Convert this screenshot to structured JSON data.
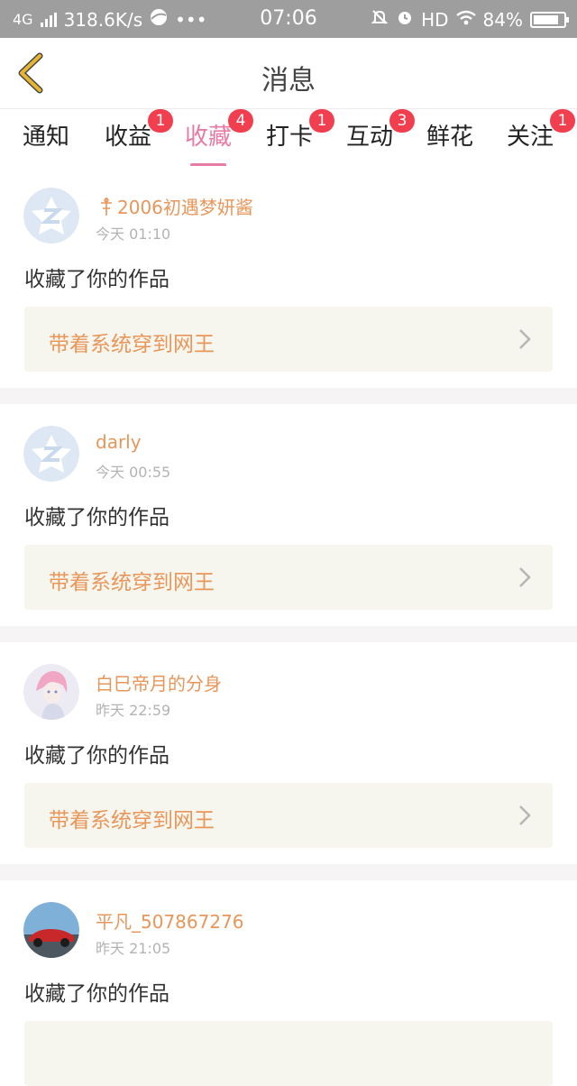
{
  "status_bar": {
    "network": "4G",
    "speed": "318.6K/s",
    "more": "•••",
    "time": "07:06",
    "hd": "HD",
    "battery": "84%",
    "battery_level": 0.84
  },
  "header": {
    "title": "消息"
  },
  "tabs": [
    {
      "label": "通知",
      "badge": "",
      "active": false
    },
    {
      "label": "收益",
      "badge": "1",
      "active": false
    },
    {
      "label": "收藏",
      "badge": "4",
      "active": true
    },
    {
      "label": "打卡",
      "badge": "1",
      "active": false
    },
    {
      "label": "互动",
      "badge": "3",
      "active": false
    },
    {
      "label": "鲜花",
      "badge": "",
      "active": false
    },
    {
      "label": "关注",
      "badge": "1",
      "active": false
    }
  ],
  "feed": [
    {
      "user": "2006初遇梦妍酱",
      "time": "今天 01:10",
      "action": "收藏了你的作品",
      "work": "带着系统穿到网王",
      "avatar": "default-avatar"
    },
    {
      "user": "darly",
      "time": "今天 00:55",
      "action": "收藏了你的作品",
      "work": "带着系统穿到网王",
      "avatar": "default-avatar"
    },
    {
      "user": "白巳帝月的分身",
      "time": "昨天 22:59",
      "action": "收藏了你的作品",
      "work": "带着系统穿到网王",
      "avatar": "anime-avatar"
    },
    {
      "user": "平凡_507867276",
      "time": "昨天 21:05",
      "action": "收藏了你的作品",
      "work": "",
      "avatar": "car-avatar"
    }
  ],
  "colors": {
    "accent_pink": "#e87ba4",
    "name_orange": "#e8965a",
    "badge_red": "#f23f50",
    "back_arrow": "#e6b630"
  }
}
